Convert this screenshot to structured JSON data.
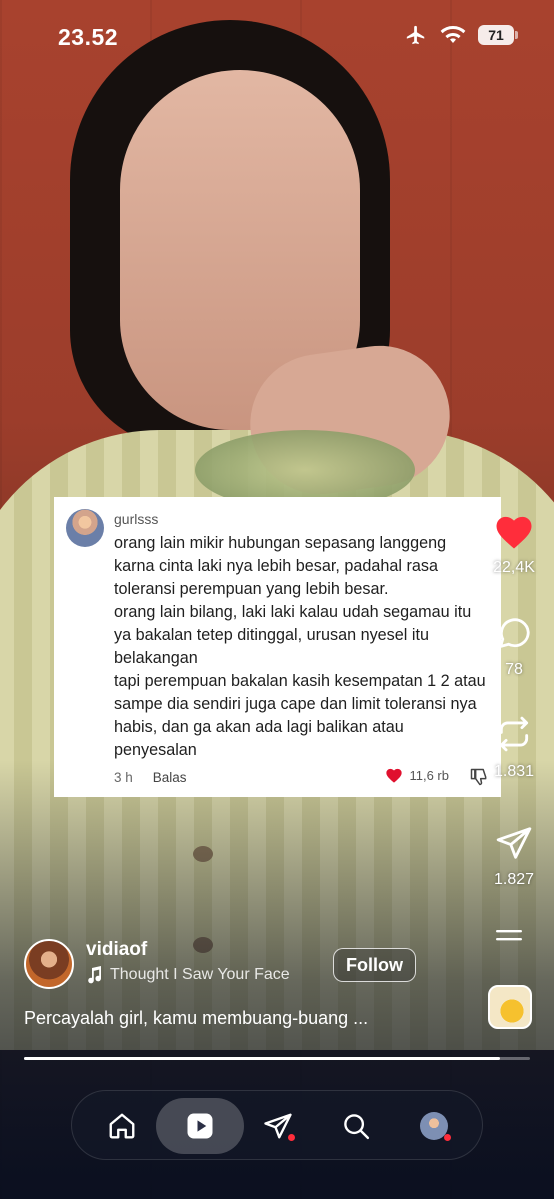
{
  "status_bar": {
    "time": "23.52",
    "battery": "71"
  },
  "comment": {
    "username": "gurlsss",
    "lines": [
      "orang lain mikir hubungan sepasang langgeng karna cinta laki nya lebih besar, padahal rasa toleransi perempuan yang lebih besar.",
      "orang lain bilang, laki laki kalau udah segamau itu ya bakalan tetep ditinggal, urusan nyesel itu belakangan",
      "tapi perempuan bakalan kasih kesempatan 1 2 atau sampe dia sendiri juga cape dan limit toleransi nya habis, dan ga akan ada lagi balikan atau penyesalan"
    ],
    "time": "3 h",
    "reply_label": "Balas",
    "likes": "11,6 rb"
  },
  "actions": {
    "likes": "22,4K",
    "comments": "78",
    "reposts": "1.831",
    "shares": "1.827"
  },
  "post": {
    "author": "vidiaof",
    "music": "Thought I Saw Your Face",
    "follow_label": "Follow",
    "caption": "Percayalah girl, kamu membuang-buang ...",
    "progress": 0.94
  },
  "colors": {
    "like_red": "#ff2d3b",
    "comment_heart": "#e0102e"
  },
  "icons": [
    "home-icon",
    "reels-icon",
    "send-icon",
    "search-icon",
    "profile-avatar"
  ]
}
